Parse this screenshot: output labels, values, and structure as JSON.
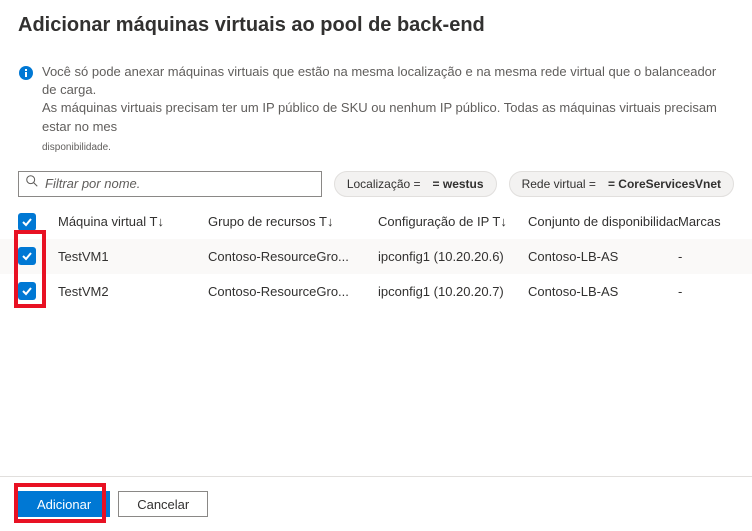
{
  "title": "Adicionar máquinas virtuais ao pool de back-end",
  "info": {
    "line1": "Você só pode anexar máquinas virtuais que estão na mesma localização e na mesma rede virtual que o balanceador de carga.",
    "line2": "As máquinas virtuais precisam ter um IP público de SKU ou nenhum IP público. Todas as máquinas virtuais precisam estar no mes",
    "sub": "disponibilidade."
  },
  "filter": {
    "placeholder": "Filtrar por nome.",
    "locationLabel": "Localização =",
    "locationValue": "= westus",
    "vnetLabel": "Rede virtual =",
    "vnetValue": "= CoreServicesVnet"
  },
  "columns": {
    "vm": "Máquina virtual T↓",
    "rg": "Grupo de recursos T↓",
    "ip": "Configuração de IP T↓",
    "avset": "Conjunto de disponibilidadeT↓",
    "tags": "Marcas"
  },
  "rows": [
    {
      "vm": "TestVM1",
      "rg": "Contoso-ResourceGro...",
      "ip": "ipconfig1 (10.20.20.6)",
      "avset": "Contoso-LB-AS",
      "tags": "-"
    },
    {
      "vm": "TestVM2",
      "rg": "Contoso-ResourceGro...",
      "ip": "ipconfig1 (10.20.20.7)",
      "avset": "Contoso-LB-AS",
      "tags": "-"
    }
  ],
  "buttons": {
    "add": "Adicionar",
    "cancel": "Cancelar"
  }
}
